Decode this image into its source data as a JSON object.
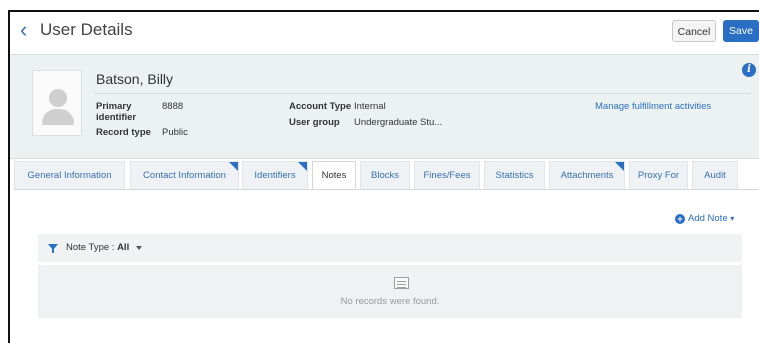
{
  "header": {
    "title": "User Details",
    "cancel_label": "Cancel",
    "save_label": "Save"
  },
  "user": {
    "name": "Batson, Billy",
    "primary_identifier_label": "Primary identifier",
    "primary_identifier_value": "8888",
    "record_type_label": "Record type",
    "record_type_value": "Public",
    "account_type_label": "Account Type",
    "account_type_value": "Internal",
    "user_group_label": "User group",
    "user_group_value": "Undergraduate Stu...",
    "manage_link": "Manage fulfillment activities"
  },
  "tabs": [
    {
      "label": "General Information",
      "active": false,
      "marked": false
    },
    {
      "label": "Contact Information",
      "active": false,
      "marked": true
    },
    {
      "label": "Identifiers",
      "active": false,
      "marked": true
    },
    {
      "label": "Notes",
      "active": true,
      "marked": false
    },
    {
      "label": "Blocks",
      "active": false,
      "marked": false
    },
    {
      "label": "Fines/Fees",
      "active": false,
      "marked": false
    },
    {
      "label": "Statistics",
      "active": false,
      "marked": false
    },
    {
      "label": "Attachments",
      "active": false,
      "marked": true
    },
    {
      "label": "Proxy For",
      "active": false,
      "marked": false
    },
    {
      "label": "Audit",
      "active": false,
      "marked": false
    }
  ],
  "notes": {
    "add_note_label": "Add Note",
    "filter_label": "Note Type :",
    "filter_value": "All",
    "empty_message": "No records were found."
  },
  "colors": {
    "accent": "#2a6fc4",
    "card_background": "#ecf2f1"
  }
}
